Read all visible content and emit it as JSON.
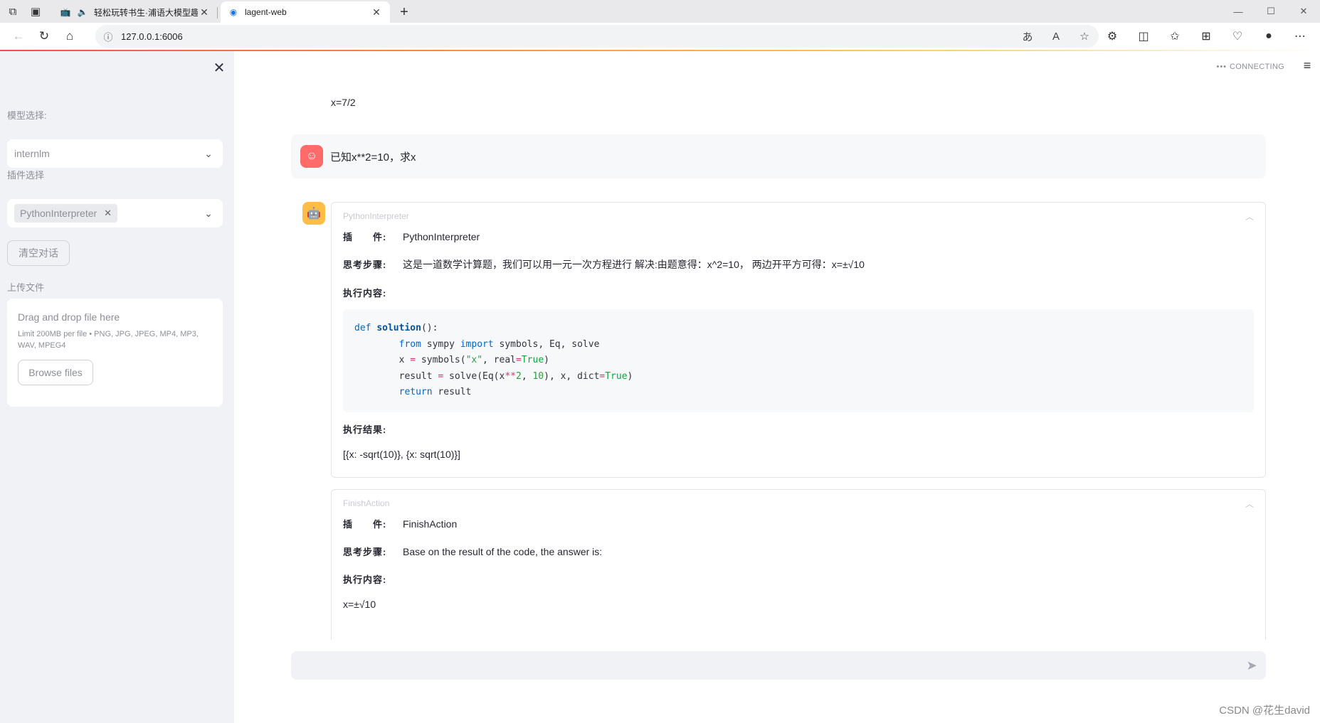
{
  "browser": {
    "tabs": [
      {
        "title": "轻松玩转书生·浦语大模型趣",
        "active": false
      },
      {
        "title": "lagent-web",
        "active": true
      }
    ],
    "url": "127.0.0.1:6006"
  },
  "sidebar": {
    "model_label": "模型选择:",
    "model_value": "internlm",
    "plugin_label": "插件选择",
    "plugin_chip": "PythonInterpreter",
    "clear_button": "清空对话",
    "upload_label": "上传文件",
    "upload_drop": "Drag and drop file here",
    "upload_limit": "Limit 200MB per file • PNG, JPG, JPEG, MP4, MP3, WAV, MPEG4",
    "browse_button": "Browse files"
  },
  "header": {
    "status": "CONNECTING"
  },
  "chat": {
    "prev_answer": "x=7/2",
    "user_message": "已知x**2=10，求x",
    "steps": [
      {
        "title": "PythonInterpreter",
        "plugin_key": "插　　件:",
        "plugin_val": "PythonInterpreter",
        "thought_key": "思考步骤:",
        "thought_val": "这是一道数学计算题，我们可以用一元一次方程进行 解决:由题意得：x^2=10， 两边开平方可得：x=±√10",
        "exec_key": "执行内容:",
        "result_key": "执行结果:",
        "result_val": "[{x: -sqrt(10)}, {x: sqrt(10)}]"
      },
      {
        "title": "FinishAction",
        "plugin_key": "插　　件:",
        "plugin_val": "FinishAction",
        "thought_key": "思考步骤:",
        "thought_val": "Base on the result of the code, the answer is:",
        "exec_key": "执行内容:",
        "exec_val": "x=±√10"
      }
    ]
  },
  "watermark": "CSDN @花生david",
  "colors": {
    "accent": "#ff4b4b",
    "user_avatar": "#ff6b6b",
    "bot_avatar": "#ffbd45",
    "sidebar_bg": "#f0f2f6"
  }
}
